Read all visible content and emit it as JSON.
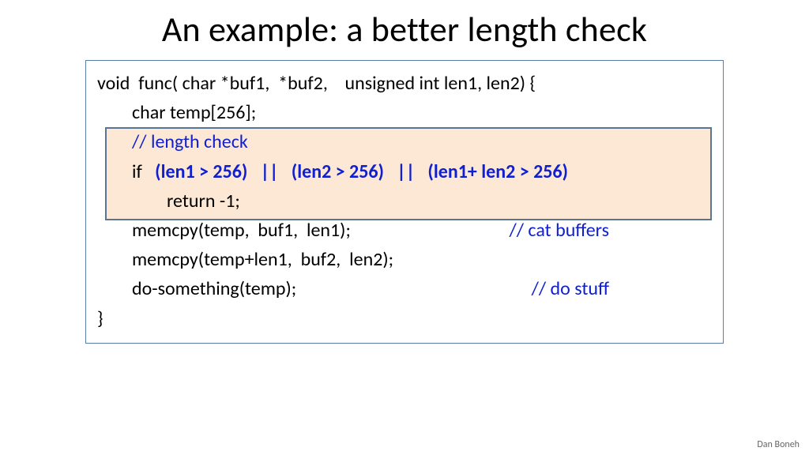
{
  "title": "An example:  a better length check",
  "code": {
    "l1": "void  func( char *buf1,  *buf2,    unsigned int len1, len2) {",
    "l2": "char temp[256];",
    "l3": "// length check",
    "l4_if": "if   ",
    "l4_cond": "(len1 > 256)   ||   (len2 > 256)   ||   (len1+ len2 > 256)",
    "l5": "return -1;",
    "l6_left": "memcpy(temp,  buf1,  len1);",
    "l6_right": "// cat buffers",
    "l7": "memcpy(temp+len1,  buf2,  len2);",
    "l8_left": "do-something(temp);",
    "l8_right": "// do stuff",
    "l9": "}"
  },
  "attribution": "Dan Boneh"
}
